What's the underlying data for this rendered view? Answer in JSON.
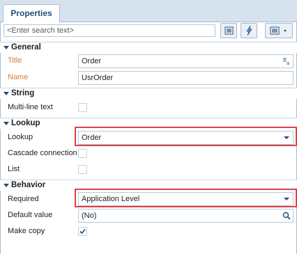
{
  "tabs": {
    "properties": "Properties"
  },
  "search": {
    "placeholder": "<Enter search text>"
  },
  "sections": {
    "general": "General",
    "string": "String",
    "lookup": "Lookup",
    "behavior": "Behavior"
  },
  "general": {
    "title_label": "Title",
    "title_value": "Order",
    "name_label": "Name",
    "name_value": "UsrOrder"
  },
  "string": {
    "multiline_label": "Multi-line text",
    "multiline_checked": false
  },
  "lookup": {
    "lookup_label": "Lookup",
    "lookup_value": "Order",
    "cascade_label": "Cascade connection",
    "cascade_checked": false,
    "list_label": "List",
    "list_checked": false
  },
  "behavior": {
    "required_label": "Required",
    "required_value": "Application Level",
    "default_label": "Default value",
    "default_value": "(No)",
    "copy_label": "Make copy",
    "copy_checked": true
  },
  "colors": {
    "accent": "#1f4e79",
    "required_label": "#e07b2a",
    "highlight": "#e0404a"
  }
}
